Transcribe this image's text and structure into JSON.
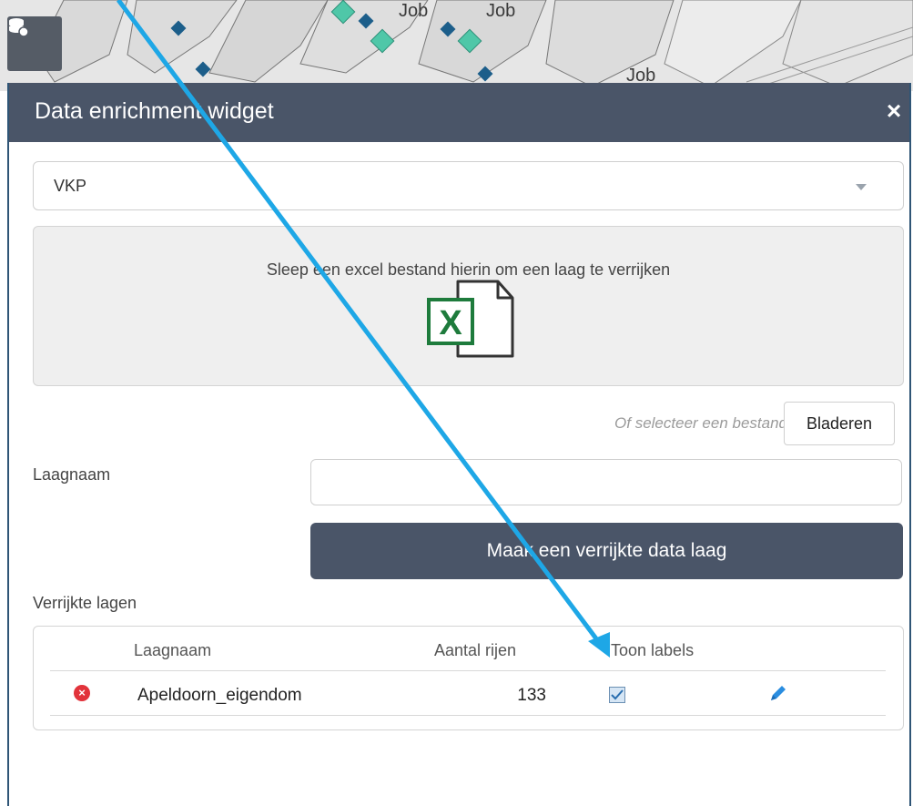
{
  "map": {
    "labels": [
      "Job",
      "Job",
      "Job"
    ]
  },
  "widget": {
    "title": "Data enrichment widget",
    "close": "×"
  },
  "select": {
    "value": "VKP"
  },
  "dropzone": {
    "text": "Sleep een excel bestand hierin om een laag te verrijken"
  },
  "browse": {
    "or_text": "Of selecteer een bestand",
    "button_label": "Bladeren"
  },
  "form": {
    "layer_name_label": "Laagnaam",
    "layer_name_value": "",
    "create_button_label": "Maak een verrijkte data laag"
  },
  "enriched_layers": {
    "title": "Verrijkte lagen",
    "columns": [
      "Laagnaam",
      "Aantal rijen",
      "Toon labels"
    ],
    "rows": [
      {
        "name": "Apeldoorn_eigendom",
        "row_count": "133",
        "show_labels": true
      }
    ]
  },
  "colors": {
    "header": "#4a5568",
    "accent": "#2a8de0",
    "annotation_arrow": "#1ea7e6",
    "delete": "#e2333b",
    "excel_green": "#1e7b3c"
  }
}
